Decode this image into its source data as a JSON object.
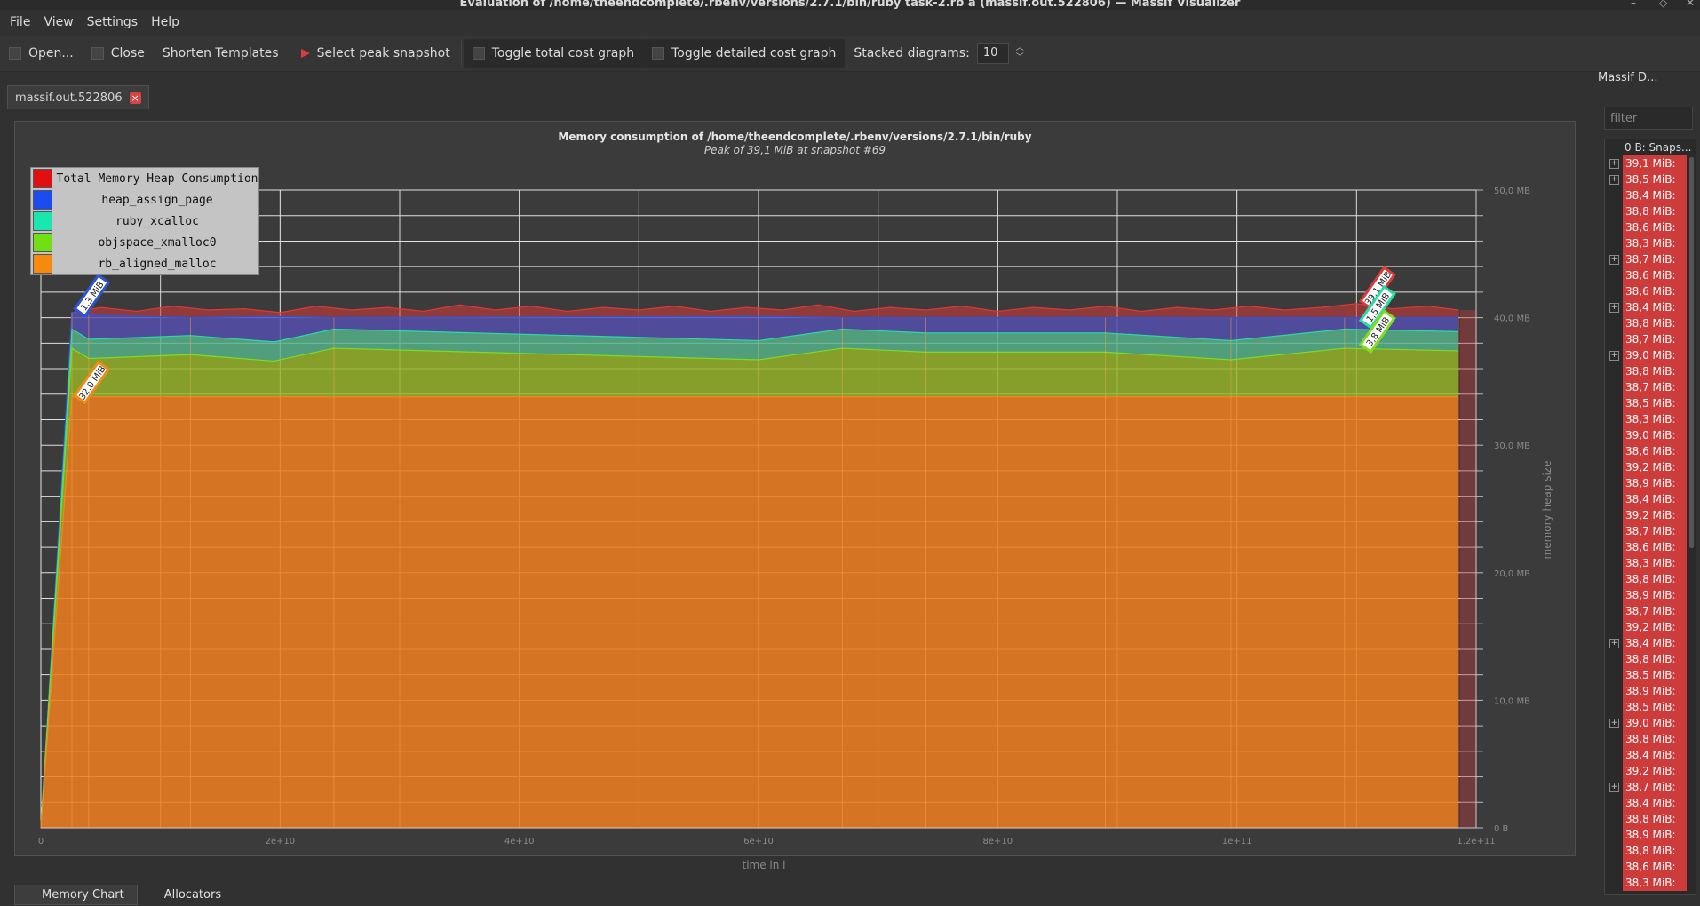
{
  "window": {
    "title": "Evaluation of /home/theendcomplete/.rbenv/versions/2.7.1/bin/ruby task-2.rb a (massif.out.522806) — Massif Visualizer",
    "min_glyph": "–",
    "max_glyph": "◇",
    "close_glyph": "✕"
  },
  "menu": [
    "File",
    "View",
    "Settings",
    "Help"
  ],
  "toolbar": {
    "open": "Open...",
    "close": "Close",
    "shorten": "Shorten Templates",
    "peak": "Select peak snapshot",
    "toggle_total": "Toggle total cost graph",
    "toggle_detailed": "Toggle detailed cost graph",
    "stacked_label": "Stacked diagrams:",
    "stacked_value": "10"
  },
  "tab": {
    "label": "massif.out.522806",
    "close": "×"
  },
  "chart_data": {
    "type": "area",
    "title": "Memory consumption of /home/theendcomplete/.rbenv/versions/2.7.1/bin/ruby",
    "subtitle": "Peak of 39,1 MiB at snapshot #69",
    "xlabel": "time in i",
    "ylabel": "memory heap size",
    "x_ticks": [
      "0",
      "2e+10",
      "4e+10",
      "6e+10",
      "8e+10",
      "1e+11",
      "1.2e+11"
    ],
    "y_ticks": [
      "0 B",
      "10,0 MB",
      "20,0 MB",
      "30,0 MB",
      "40,0 MB",
      "50,0 MB"
    ],
    "xlim": [
      0,
      120000000000.0
    ],
    "ylim": [
      0,
      50
    ],
    "legend": [
      "Total Memory Heap Consumption",
      "heap_assign_page",
      "ruby_xcalloc",
      "objspace_xmalloc0",
      "rb_aligned_malloc"
    ],
    "colors": {
      "total": "#d93a3a",
      "heap_assign_page": "#2a55d8",
      "ruby_xcalloc": "#2adba6",
      "objspace_xmalloc0": "#7fdc21",
      "rb_aligned_malloc": "#f08a19"
    },
    "x": [
      0,
      2600000000.0,
      4000000000.0,
      12500000000.0,
      19500000000.0,
      24500000000.0,
      60000000000.0,
      67000000000.0,
      74000000000.0,
      89000000000.0,
      99500000000.0,
      109000000000.0,
      118500000000.0
    ],
    "series": [
      {
        "name": "rb_aligned_malloc",
        "values": [
          0,
          33.8,
          33.8,
          33.8,
          33.8,
          33.8,
          33.8,
          33.8,
          33.8,
          33.8,
          33.8,
          33.8,
          33.8
        ]
      },
      {
        "name": "objspace_xmalloc0",
        "values": [
          0,
          3.8,
          3.0,
          3.3,
          2.8,
          3.8,
          2.9,
          3.8,
          3.5,
          3.5,
          2.9,
          3.8,
          3.6
        ]
      },
      {
        "name": "ruby_xcalloc",
        "values": [
          0,
          1.5,
          1.5,
          1.5,
          1.5,
          1.5,
          1.5,
          1.5,
          1.5,
          1.5,
          1.5,
          1.5,
          1.5
        ]
      },
      {
        "name": "heap_assign_page",
        "values": [
          0,
          1.3,
          1.9,
          1.4,
          2.0,
          0.9,
          1.9,
          0.9,
          1.2,
          1.2,
          1.8,
          0.9,
          1.1
        ]
      }
    ],
    "total_x": [
      0,
      2600000000.0,
      5000000000.0,
      8000000000.0,
      11000000000.0,
      14000000000.0,
      17000000000.0,
      20000000000.0,
      23000000000.0,
      26000000000.0,
      29000000000.0,
      32000000000.0,
      35000000000.0,
      38000000000.0,
      41000000000.0,
      44000000000.0,
      47000000000.0,
      50000000000.0,
      53000000000.0,
      56000000000.0,
      59000000000.0,
      62000000000.0,
      65000000000.0,
      68000000000.0,
      71000000000.0,
      74000000000.0,
      77000000000.0,
      80000000000.0,
      83000000000.0,
      86000000000.0,
      89000000000.0,
      92000000000.0,
      95000000000.0,
      98000000000.0,
      101000000000.0,
      104000000000.0,
      107000000000.0,
      110000000000.0,
      113000000000.0,
      116000000000.0,
      118500000000.0
    ],
    "total": [
      0,
      40.4,
      40.8,
      40.5,
      40.9,
      40.6,
      40.7,
      40.4,
      40.9,
      40.6,
      40.8,
      40.5,
      41.0,
      40.6,
      40.9,
      40.5,
      40.8,
      40.6,
      40.9,
      40.5,
      40.8,
      40.6,
      41.0,
      40.5,
      40.8,
      40.6,
      40.9,
      40.5,
      40.8,
      40.6,
      40.9,
      40.5,
      40.8,
      40.6,
      40.9,
      40.6,
      40.8,
      41.1,
      40.7,
      40.9,
      40.6
    ],
    "annotations": [
      {
        "text": "1,3 MiB",
        "x": 3500000000.0,
        "y": 40.6,
        "color": "#2a55d8"
      },
      {
        "text": "32,0 MiB",
        "x": 3500000000.0,
        "y": 33.8,
        "color": "#f08a19"
      },
      {
        "text": "39,1 MiB",
        "x": 111000000000.0,
        "y": 41.2,
        "color": "#d93a3a"
      },
      {
        "text": "1,5 MiB",
        "x": 111000000000.0,
        "y": 39.7,
        "color": "#2adba6"
      },
      {
        "text": "3,8 MiB",
        "x": 111000000000.0,
        "y": 37.8,
        "color": "#7fdc21"
      }
    ]
  },
  "bottom_tabs": [
    "Memory Chart",
    "Allocators"
  ],
  "right_panel": {
    "title": "Massif D...",
    "filter_placeholder": "filter",
    "header": "0 B: Snaps...",
    "snapshots": [
      {
        "label": "39,1 MiB: ...",
        "expandable": true
      },
      {
        "label": "38,5 MiB: ...",
        "expandable": true
      },
      {
        "label": "38,4 MiB: ...",
        "expandable": false
      },
      {
        "label": "38,8 MiB: ...",
        "expandable": false
      },
      {
        "label": "38,6 MiB: ...",
        "expandable": false
      },
      {
        "label": "38,3 MiB: ...",
        "expandable": false
      },
      {
        "label": "38,7 MiB: ...",
        "expandable": true
      },
      {
        "label": "38,6 MiB: ...",
        "expandable": false
      },
      {
        "label": "38,6 MiB: ...",
        "expandable": false
      },
      {
        "label": "38,4 MiB: ...",
        "expandable": true
      },
      {
        "label": "38,8 MiB: ...",
        "expandable": false
      },
      {
        "label": "38,7 MiB: ...",
        "expandable": false
      },
      {
        "label": "39,0 MiB: ...",
        "expandable": true
      },
      {
        "label": "38,8 MiB: ...",
        "expandable": false
      },
      {
        "label": "38,7 MiB: ...",
        "expandable": false
      },
      {
        "label": "38,5 MiB: ...",
        "expandable": false
      },
      {
        "label": "38,3 MiB: ...",
        "expandable": false
      },
      {
        "label": "39,0 MiB: ...",
        "expandable": false
      },
      {
        "label": "38,6 MiB: ...",
        "expandable": false
      },
      {
        "label": "39,2 MiB: ...",
        "expandable": false
      },
      {
        "label": "38,9 MiB: ...",
        "expandable": false
      },
      {
        "label": "38,4 MiB: ...",
        "expandable": false
      },
      {
        "label": "39,2 MiB: ...",
        "expandable": false
      },
      {
        "label": "38,7 MiB: ...",
        "expandable": false
      },
      {
        "label": "38,6 MiB: ...",
        "expandable": false
      },
      {
        "label": "38,3 MiB: ...",
        "expandable": false
      },
      {
        "label": "38,8 MiB: ...",
        "expandable": false
      },
      {
        "label": "38,9 MiB: ...",
        "expandable": false
      },
      {
        "label": "38,7 MiB: ...",
        "expandable": false
      },
      {
        "label": "39,2 MiB: ...",
        "expandable": false
      },
      {
        "label": "38,4 MiB: ...",
        "expandable": true
      },
      {
        "label": "38,8 MiB: ...",
        "expandable": false
      },
      {
        "label": "38,5 MiB: ...",
        "expandable": false
      },
      {
        "label": "38,9 MiB: ...",
        "expandable": false
      },
      {
        "label": "38,5 MiB: ...",
        "expandable": false
      },
      {
        "label": "39,0 MiB: ...",
        "expandable": true
      },
      {
        "label": "38,8 MiB: ...",
        "expandable": false
      },
      {
        "label": "38,4 MiB: ...",
        "expandable": false
      },
      {
        "label": "39,2 MiB: ...",
        "expandable": false
      },
      {
        "label": "38,7 MiB: ...",
        "expandable": true
      },
      {
        "label": "38,4 MiB: ...",
        "expandable": false
      },
      {
        "label": "38,8 MiB: ...",
        "expandable": false
      },
      {
        "label": "38,9 MiB: ...",
        "expandable": false
      },
      {
        "label": "38,8 MiB: ...",
        "expandable": false
      },
      {
        "label": "38,6 MiB: ...",
        "expandable": false
      },
      {
        "label": "38,3 MiB: ...",
        "expandable": false
      }
    ]
  }
}
